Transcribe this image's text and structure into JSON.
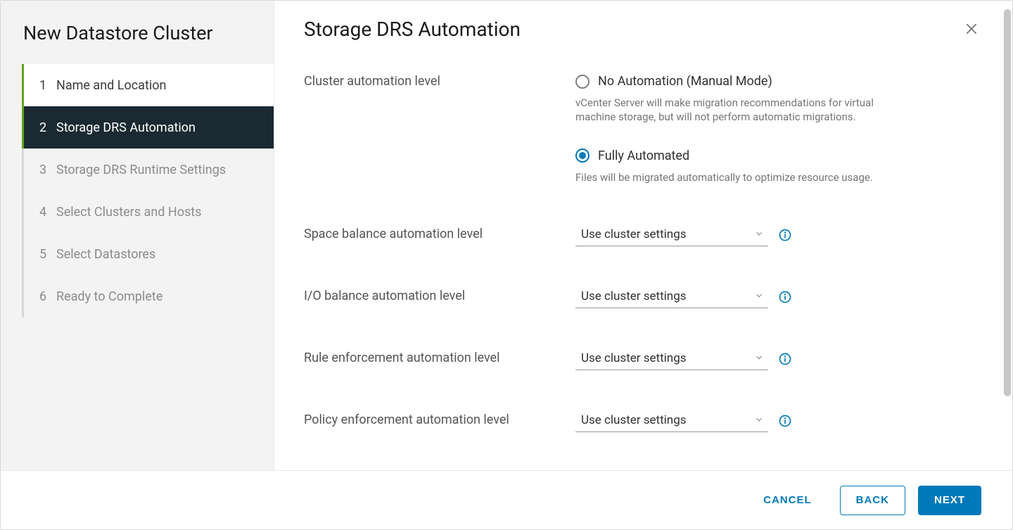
{
  "wizard": {
    "title": "New Datastore Cluster",
    "steps": [
      {
        "num": "1",
        "label": "Name and Location",
        "state": "completed"
      },
      {
        "num": "2",
        "label": "Storage DRS Automation",
        "state": "active"
      },
      {
        "num": "3",
        "label": "Storage DRS Runtime Settings",
        "state": "upcoming"
      },
      {
        "num": "4",
        "label": "Select Clusters and Hosts",
        "state": "upcoming"
      },
      {
        "num": "5",
        "label": "Select Datastores",
        "state": "upcoming"
      },
      {
        "num": "6",
        "label": "Ready to Complete",
        "state": "upcoming"
      }
    ]
  },
  "page": {
    "title": "Storage DRS Automation",
    "cluster_automation": {
      "label": "Cluster automation level",
      "options": [
        {
          "label": "No Automation (Manual Mode)",
          "desc": "vCenter Server will make migration recommendations for virtual machine storage, but will not perform automatic migrations.",
          "checked": false
        },
        {
          "label": "Fully Automated",
          "desc": "Files will be migrated automatically to optimize resource usage.",
          "checked": true
        }
      ]
    },
    "selects": {
      "default_value": "Use cluster settings",
      "rows": [
        {
          "label": "Space balance automation level",
          "value": "Use cluster settings"
        },
        {
          "label": "I/O balance automation level",
          "value": "Use cluster settings"
        },
        {
          "label": "Rule enforcement automation level",
          "value": "Use cluster settings"
        },
        {
          "label": "Policy enforcement automation level",
          "value": "Use cluster settings"
        }
      ]
    }
  },
  "footer": {
    "cancel": "CANCEL",
    "back": "BACK",
    "next": "NEXT"
  },
  "icons": {
    "close": "close-icon",
    "chevron_down": "chevron-down-icon",
    "info": "info-icon"
  }
}
